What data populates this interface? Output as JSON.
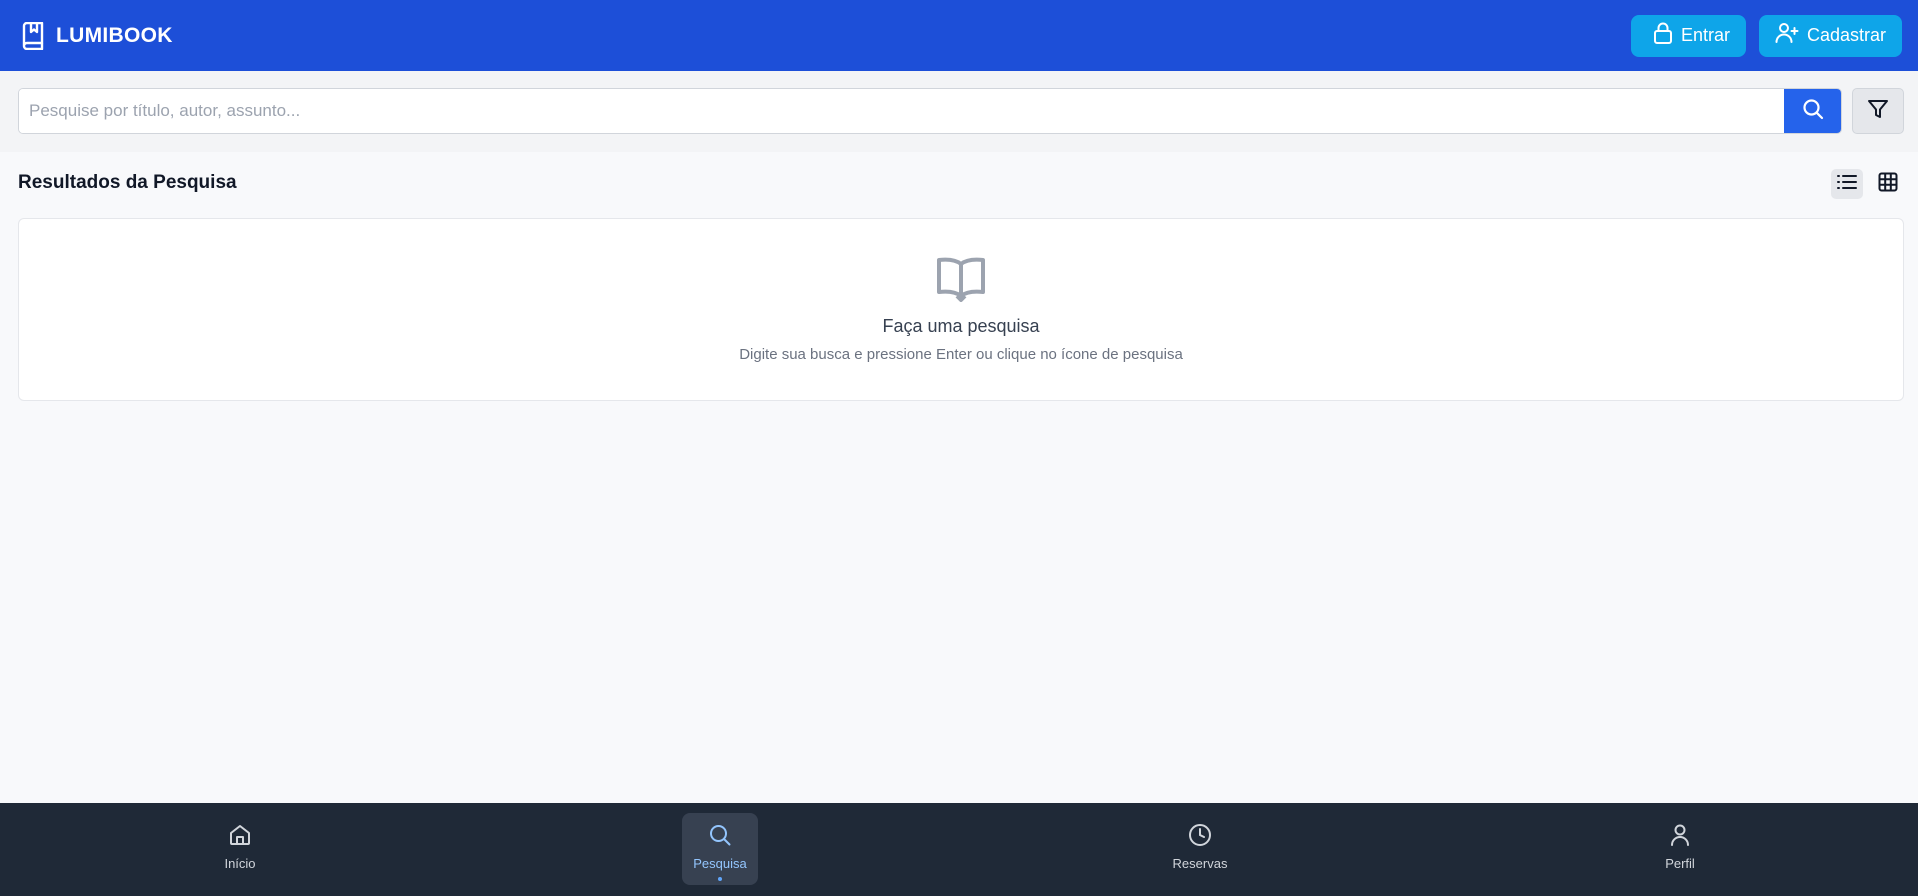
{
  "app": {
    "brand": "LUMIBOOK"
  },
  "header": {
    "login_label": "Entrar",
    "signup_label": "Cadastrar"
  },
  "search": {
    "placeholder": "Pesquise por título, autor, assunto...",
    "value": ""
  },
  "results": {
    "title": "Resultados da Pesquisa",
    "view_mode": "list"
  },
  "empty_state": {
    "title": "Faça uma pesquisa",
    "subtitle": "Digite sua busca e pressione Enter ou clique no ícone de pesquisa"
  },
  "nav": {
    "items": [
      {
        "label": "Início",
        "icon": "home-icon",
        "active": false
      },
      {
        "label": "Pesquisa",
        "icon": "search-icon",
        "active": true
      },
      {
        "label": "Reservas",
        "icon": "clock-icon",
        "active": false
      },
      {
        "label": "Perfil",
        "icon": "user-icon",
        "active": false
      }
    ]
  },
  "colors": {
    "header_bg": "#1d4fd8",
    "auth_button": "#0ea5e9",
    "search_button": "#2563eb",
    "bottom_nav_bg": "#1f2937",
    "nav_active": "#93c5fd"
  }
}
